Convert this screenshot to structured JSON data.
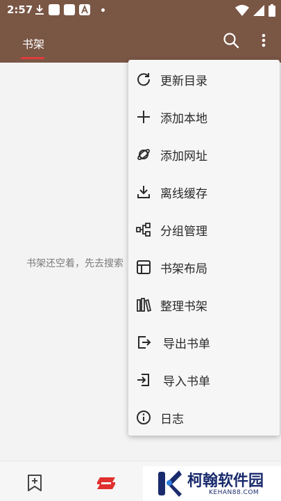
{
  "status_bar": {
    "time": "2:57"
  },
  "app_bar": {
    "tab_label": "书架"
  },
  "content": {
    "empty_message": "书架还空着，先去搜索"
  },
  "menu": {
    "items": [
      {
        "label": "更新目录",
        "icon": "refresh-icon"
      },
      {
        "label": "添加本地",
        "icon": "plus-icon"
      },
      {
        "label": "添加网址",
        "icon": "planet-icon"
      },
      {
        "label": "离线缓存",
        "icon": "download-icon"
      },
      {
        "label": "分组管理",
        "icon": "group-icon"
      },
      {
        "label": "书架布局",
        "icon": "layout-icon"
      },
      {
        "label": "整理书架",
        "icon": "books-icon"
      },
      {
        "label": "导出书单",
        "icon": "export-icon"
      },
      {
        "label": "导入书单",
        "icon": "import-icon"
      },
      {
        "label": "日志",
        "icon": "info-icon"
      }
    ]
  },
  "watermark": {
    "title": "柯翰软件园",
    "subtitle": "KEHAN88.COM"
  },
  "colors": {
    "app_bar": "#7a5645",
    "tab_indicator": "#e23b3b",
    "background": "#f3f3f3",
    "brand_blue": "#1a2b6d"
  }
}
